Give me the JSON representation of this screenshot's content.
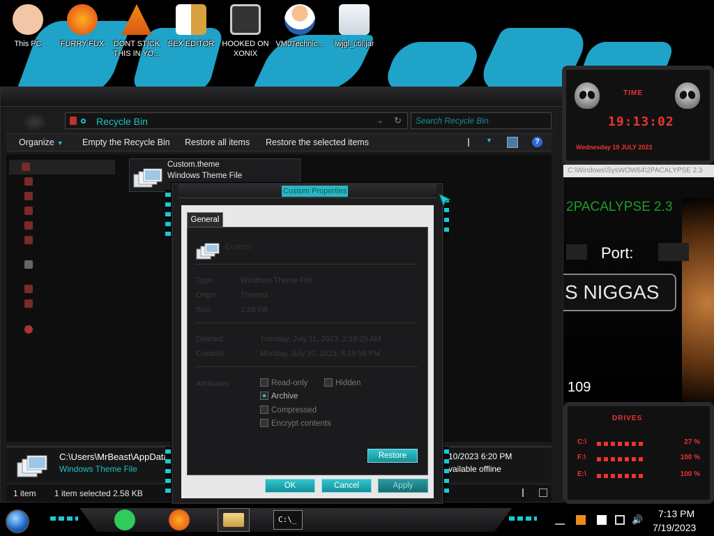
{
  "desktop": {
    "icons": [
      {
        "label": "This PC",
        "color": "#f0c0a0"
      },
      {
        "label": "FURRY FUX",
        "color": "#e56a1a"
      },
      {
        "label": "DONT STICK THIS IN YO...",
        "color": "#f08a1a"
      },
      {
        "label": "SEX EDITOR",
        "color": "#d9a040"
      },
      {
        "label": "HOOKED ON XONIX",
        "color": "#444"
      },
      {
        "label": "VM0Technic...",
        "color": "#f0a060"
      },
      {
        "label": "lwjgl_util.jar",
        "color": "#e0e8f0"
      }
    ]
  },
  "explorer": {
    "address_path": "Recycle Bin",
    "search_placeholder": "Search Recycle Bin",
    "toolbar": {
      "organize": "Organize",
      "empty": "Empty the Recycle Bin",
      "restore_all": "Restore all items",
      "restore_selected": "Restore the selected items"
    },
    "file": {
      "name": "Custom.theme",
      "type": "Windows Theme File"
    },
    "details": {
      "path": "C:\\Users\\MrBeast\\AppData",
      "type": "Windows Theme File",
      "date": "10/2023 6:20 PM",
      "availability": "vailable offline"
    },
    "status": {
      "count": "1 item",
      "selection": "1 item selected  2.58 KB"
    }
  },
  "properties": {
    "title": "Custom Properties",
    "tab": "General",
    "name": "Custom",
    "type_label": "Type:",
    "type_value": "Windows Theme File",
    "origin_label": "Origin:",
    "origin_value": "Themes",
    "size_label": "Size:",
    "size_value": "2.58 KB",
    "deleted_label": "Deleted:",
    "deleted_value": "Tuesday, July 11, 2023, 2:19:25 AM",
    "created_label": "Created:",
    "created_value": "Monday, July 10, 2023, 6:19:58 PM",
    "attributes_label": "Attributes:",
    "attributes": {
      "readonly": "Read-only",
      "hidden": "Hidden",
      "archive": "Archive",
      "compressed": "Compressed",
      "encrypt": "Encrypt contents"
    },
    "restore": "Restore",
    "ok": "OK",
    "cancel": "Cancel",
    "apply": "Apply"
  },
  "widgets": {
    "time_title": "TIME",
    "time": "19:13:02",
    "date": "Wednesday 19 JULY 2023",
    "path_strip": "C:\\Windows\\SysWOW64\\2PACALYPSE 2.3",
    "app_title": "2PACALYPSE  2.3",
    "port_label": "Port:",
    "banner": "S NIGGAS",
    "number": "109",
    "drives_title": "DRIVES",
    "drives": [
      {
        "letter": "C:\\",
        "pct": "27 %"
      },
      {
        "letter": "F:\\",
        "pct": "100 %"
      },
      {
        "letter": "E:\\",
        "pct": "100 %"
      }
    ]
  },
  "taskbar": {
    "time": "7:13 PM",
    "date": "7/19/2023"
  }
}
